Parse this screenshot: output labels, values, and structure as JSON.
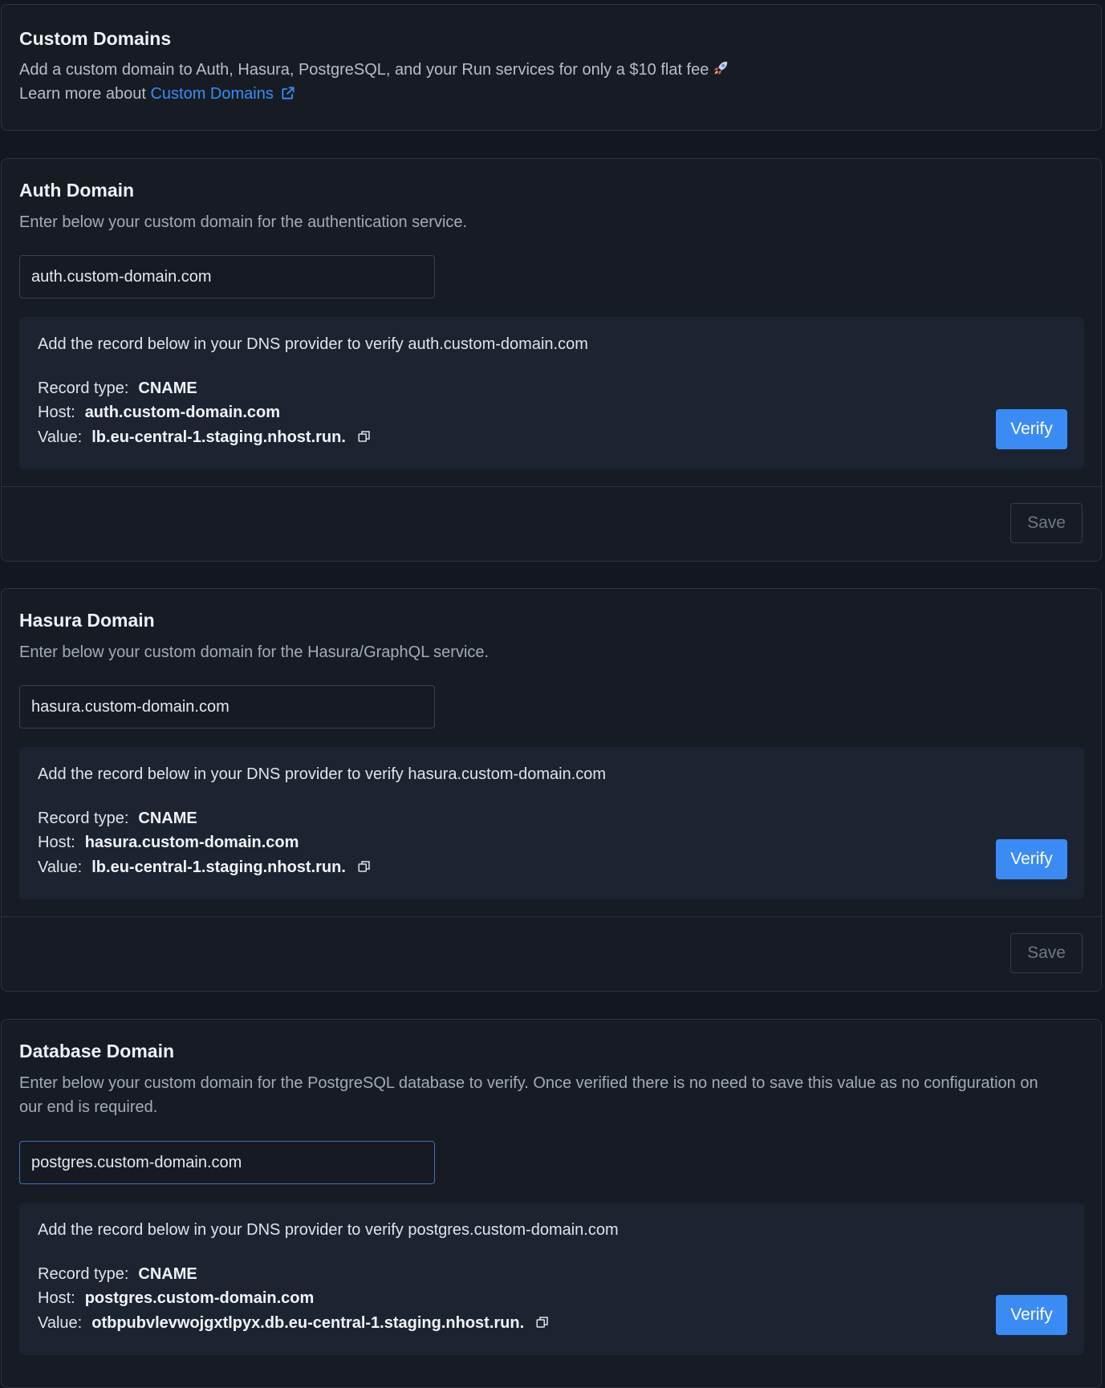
{
  "intro": {
    "title": "Custom Domains",
    "description": "Add a custom domain to Auth, Hasura, PostgreSQL, and your Run services for only a $10 flat fee",
    "learn_more_prefix": "Learn more about",
    "learn_more_link": "Custom Domains"
  },
  "auth": {
    "title": "Auth Domain",
    "description": "Enter below your custom domain for the authentication service.",
    "input_value": "auth.custom-domain.com",
    "dns_instruction": "Add the record below in your DNS provider to verify auth.custom-domain.com",
    "record_type_label": "Record type:",
    "record_type": "CNAME",
    "host_label": "Host:",
    "host": "auth.custom-domain.com",
    "value_label": "Value:",
    "value": "lb.eu-central-1.staging.nhost.run.",
    "verify_label": "Verify",
    "save_label": "Save"
  },
  "hasura": {
    "title": "Hasura Domain",
    "description": "Enter below your custom domain for the Hasura/GraphQL service.",
    "input_value": "hasura.custom-domain.com",
    "dns_instruction": "Add the record below in your DNS provider to verify hasura.custom-domain.com",
    "record_type_label": "Record type:",
    "record_type": "CNAME",
    "host_label": "Host:",
    "host": "hasura.custom-domain.com",
    "value_label": "Value:",
    "value": "lb.eu-central-1.staging.nhost.run.",
    "verify_label": "Verify",
    "save_label": "Save"
  },
  "database": {
    "title": "Database Domain",
    "description": "Enter below your custom domain for the PostgreSQL database to verify. Once verified there is no need to save this value as no configuration on our end is required.",
    "input_value": "postgres.custom-domain.com",
    "dns_instruction": "Add the record below in your DNS provider to verify postgres.custom-domain.com",
    "record_type_label": "Record type:",
    "record_type": "CNAME",
    "host_label": "Host:",
    "host": "postgres.custom-domain.com",
    "value_label": "Value:",
    "value": "otbpubvlevwojgxtlpyx.db.eu-central-1.staging.nhost.run.",
    "verify_label": "Verify"
  },
  "icons": {
    "external_link": "external-link-icon",
    "copy": "copy-icon",
    "rocket": "rocket-icon"
  },
  "colors": {
    "background": "#131820",
    "card": "#171c24",
    "dns_box": "#1c2432",
    "accent": "#3b8bf5"
  }
}
